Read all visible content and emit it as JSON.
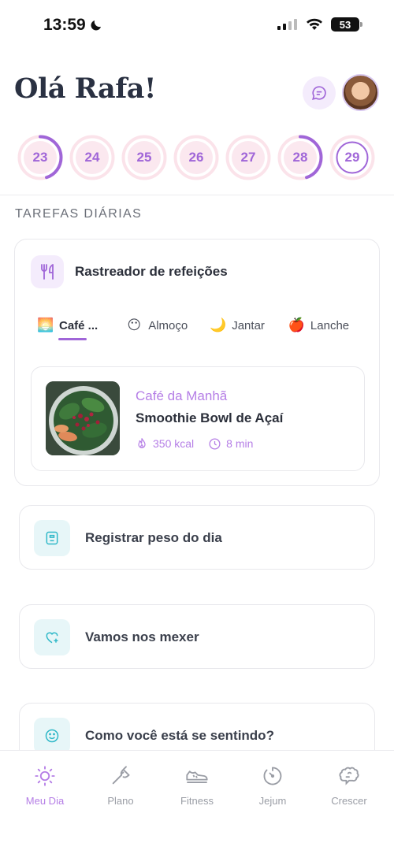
{
  "status_bar": {
    "time": "13:59",
    "battery": "53"
  },
  "header": {
    "greeting": "Olá Rafa!"
  },
  "days": [
    {
      "label": "23",
      "progress": 0.45
    },
    {
      "label": "24",
      "progress": 0
    },
    {
      "label": "25",
      "progress": 0
    },
    {
      "label": "26",
      "progress": 0
    },
    {
      "label": "27",
      "progress": 0
    },
    {
      "label": "28",
      "progress": 0.45
    },
    {
      "label": "29",
      "progress": 0,
      "selected": true
    }
  ],
  "section_title": "TAREFAS DIÁRIAS",
  "meal_tracker": {
    "title": "Rastreador de refeições",
    "tabs": [
      {
        "emoji": "🌅",
        "label": "Café ..."
      },
      {
        "emoji": "😶",
        "label": "Almoço"
      },
      {
        "emoji": "🌙",
        "label": "Jantar"
      },
      {
        "emoji": "🍎",
        "label": "Lanche"
      }
    ],
    "recipe": {
      "category": "Café da Manhã",
      "name": "Smoothie Bowl de Açaí",
      "kcal": "350 kcal",
      "time": "8 min"
    }
  },
  "tasks": [
    {
      "label": "Registrar peso do dia",
      "icon": "scale-icon"
    },
    {
      "label": "Vamos nos mexer",
      "icon": "heart-plus-icon"
    },
    {
      "label": "Como você está se sentindo?",
      "icon": "smile-icon"
    }
  ],
  "bottom_nav": [
    {
      "label": "Meu Dia",
      "icon": "sun-icon",
      "active": true
    },
    {
      "label": "Plano",
      "icon": "fork-icon"
    },
    {
      "label": "Fitness",
      "icon": "sneaker-icon"
    },
    {
      "label": "Jejum",
      "icon": "timer-icon"
    },
    {
      "label": "Crescer",
      "icon": "brain-icon"
    }
  ],
  "colors": {
    "accent": "#a066d8",
    "ring_bg": "#fbe3ea",
    "teal_bg": "#e7f6f8",
    "teal": "#2fb8c8"
  }
}
